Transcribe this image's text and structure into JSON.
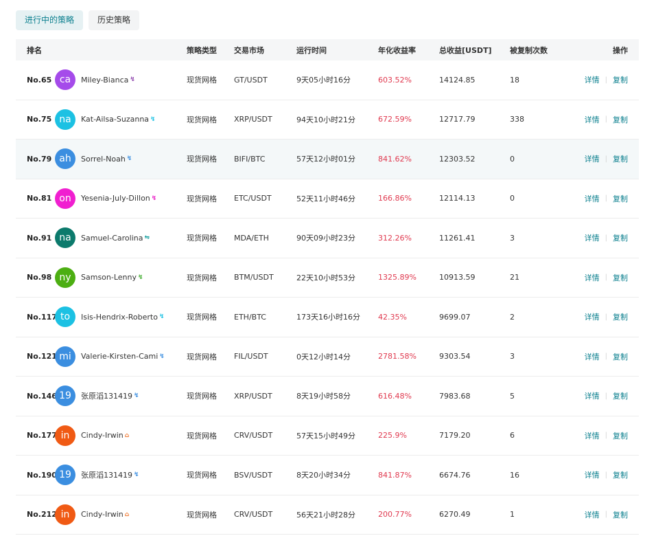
{
  "tabs": [
    {
      "label": "进行中的策略",
      "active": true
    },
    {
      "label": "历史策略",
      "active": false
    }
  ],
  "table": {
    "headers": {
      "rank": "排名",
      "type": "策略类型",
      "market": "交易市场",
      "time": "运行时间",
      "rate": "年化收益率",
      "total": "总收益[USDT]",
      "copies": "被复制次数",
      "ops": "操作"
    },
    "detail_label": "详情",
    "copy_label": "复制",
    "rows": [
      {
        "rank": "No.65",
        "avatar": "ca",
        "avatar_color": "#a54bea",
        "name": "Miley-Bianca",
        "badge": "↯",
        "badge_color": "#8e44ad",
        "type": "现货网格",
        "market": "GT/USDT",
        "time": "9天05小时16分",
        "rate": "603.52%",
        "total": "14124.85",
        "copies": "18"
      },
      {
        "rank": "No.75",
        "avatar": "na",
        "avatar_color": "#1cc1e3",
        "name": "Kat-Ailsa-Suzanna",
        "badge": "↯",
        "badge_color": "#1cc1e3",
        "type": "现货网格",
        "market": "XRP/USDT",
        "time": "94天10小时21分",
        "rate": "672.59%",
        "total": "12717.79",
        "copies": "338"
      },
      {
        "rank": "No.79",
        "avatar": "ah",
        "avatar_color": "#3b8ee0",
        "name": "Sorrel-Noah",
        "badge": "↯",
        "badge_color": "#3b8ee0",
        "type": "现货网格",
        "market": "BIFI/BTC",
        "time": "57天12小时01分",
        "rate": "841.62%",
        "total": "12303.52",
        "copies": "0"
      },
      {
        "rank": "No.81",
        "avatar": "on",
        "avatar_color": "#f01fd0",
        "name": "Yesenia-July-Dillon",
        "badge": "↯",
        "badge_color": "#e91ec6",
        "type": "现货网格",
        "market": "ETC/USDT",
        "time": "52天11小时46分",
        "rate": "166.86%",
        "total": "12114.13",
        "copies": "0"
      },
      {
        "rank": "No.91",
        "avatar": "na",
        "avatar_color": "#0c7a6c",
        "name": "Samuel-Carolina",
        "badge": "⇋",
        "badge_color": "#1aa0a0",
        "type": "现货网格",
        "market": "MDA/ETH",
        "time": "90天09小时23分",
        "rate": "312.26%",
        "total": "11261.41",
        "copies": "3"
      },
      {
        "rank": "No.98",
        "avatar": "ny",
        "avatar_color": "#4cae12",
        "name": "Samson-Lenny",
        "badge": "↯",
        "badge_color": "#3caa2a",
        "type": "现货网格",
        "market": "BTM/USDT",
        "time": "22天10小时53分",
        "rate": "1325.89%",
        "total": "10913.59",
        "copies": "21"
      },
      {
        "rank": "No.117",
        "avatar": "to",
        "avatar_color": "#1cc1e3",
        "name": "Isis-Hendrix-Roberto",
        "badge": "↯",
        "badge_color": "#1cc1e3",
        "type": "现货网格",
        "market": "ETH/BTC",
        "time": "173天16小时16分",
        "rate": "42.35%",
        "total": "9699.07",
        "copies": "2"
      },
      {
        "rank": "No.121",
        "avatar": "mi",
        "avatar_color": "#3b8ee0",
        "name": "Valerie-Kirsten-Cami",
        "badge": "↯",
        "badge_color": "#3b8ee0",
        "type": "现货网格",
        "market": "FIL/USDT",
        "time": "0天12小时14分",
        "rate": "2781.58%",
        "total": "9303.54",
        "copies": "3"
      },
      {
        "rank": "No.146",
        "avatar": "19",
        "avatar_color": "#3b8ee0",
        "name": "张原滔131419",
        "badge": "↯",
        "badge_color": "#3b8ee0",
        "type": "现货网格",
        "market": "XRP/USDT",
        "time": "8天19小时58分",
        "rate": "616.48%",
        "total": "7983.68",
        "copies": "5"
      },
      {
        "rank": "No.177",
        "avatar": "in",
        "avatar_color": "#f05a14",
        "name": "Cindy-Irwin",
        "badge": "⌂",
        "badge_color": "#f07a34",
        "type": "现货网格",
        "market": "CRV/USDT",
        "time": "57天15小时49分",
        "rate": "225.9%",
        "total": "7179.20",
        "copies": "6"
      },
      {
        "rank": "No.190",
        "avatar": "19",
        "avatar_color": "#3b8ee0",
        "name": "张原滔131419",
        "badge": "↯",
        "badge_color": "#3b8ee0",
        "type": "现货网格",
        "market": "BSV/USDT",
        "time": "8天20小时34分",
        "rate": "841.87%",
        "total": "6674.76",
        "copies": "16"
      },
      {
        "rank": "No.212",
        "avatar": "in",
        "avatar_color": "#f05a14",
        "name": "Cindy-Irwin",
        "badge": "⌂",
        "badge_color": "#f07a34",
        "type": "现货网格",
        "market": "CRV/USDT",
        "time": "56天21小时28分",
        "rate": "200.77%",
        "total": "6270.49",
        "copies": "1"
      }
    ]
  }
}
